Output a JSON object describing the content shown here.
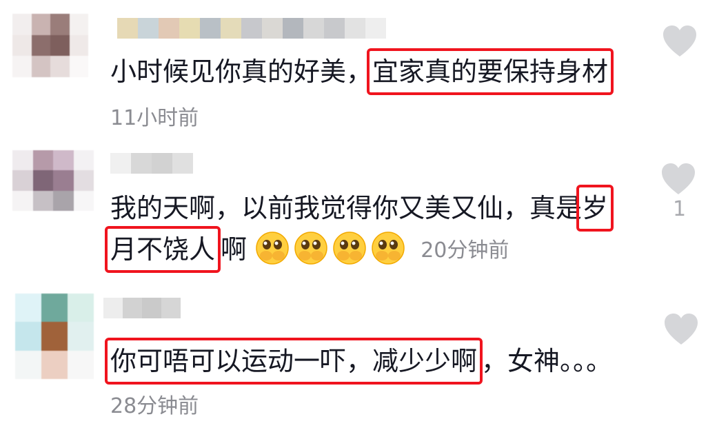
{
  "comments": [
    {
      "text_before": "小时候见你真的好美，",
      "text_highlight": "宜家真的要保持身材",
      "time": "11小时前",
      "likes": ""
    },
    {
      "line1_before": "我的天啊，以前我觉得你又美又仙，真是",
      "line1_highlight": "岁",
      "line2_highlight": "月不饶人",
      "line2_after": "啊",
      "emojis": [
        "emoji-cover-mouth-icon",
        "emoji-cover-mouth-icon",
        "emoji-cover-mouth-icon",
        "emoji-cover-mouth-icon"
      ],
      "time": "20分钟前",
      "likes": "1"
    },
    {
      "text_highlight": "你可唔可以运动一吓，减少少啊",
      "text_after": "，女神。。。",
      "time": "28分钟前",
      "likes": ""
    }
  ],
  "colors": {
    "highlight_border": "#f0141e",
    "time_text": "#8a8b91",
    "heart_icon": "#d5d6d9"
  },
  "icons": {
    "like": "heart-icon"
  }
}
